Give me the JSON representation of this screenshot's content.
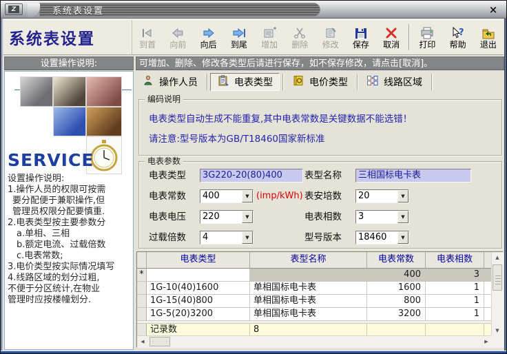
{
  "window": {
    "title": "系统表设置"
  },
  "icons": {
    "dropdown_arrow": "▼",
    "scroll_up": "▲",
    "scroll_down": "▼",
    "scroll_left": "◀",
    "scroll_right": "▶",
    "close": "×",
    "logo_glyph": "Z"
  },
  "colors": {
    "accent_navy": "#23238f",
    "field_lavender": "#c9c9f0",
    "info_blue": "#2424b0",
    "warning_red": "#e00000",
    "header_gray": "#838587",
    "footer_yellow": "#fcfbdc"
  },
  "toolbar": {
    "app_title": "系统表设置",
    "buttons": [
      {
        "label": "到首",
        "enabled": false
      },
      {
        "label": "向前",
        "enabled": false
      },
      {
        "label": "向后",
        "enabled": true
      },
      {
        "label": "到尾",
        "enabled": true
      },
      {
        "label": "增加",
        "enabled": false
      },
      {
        "label": "删除",
        "enabled": false
      },
      {
        "label": "修改",
        "enabled": false
      },
      {
        "label": "保存",
        "enabled": true
      },
      {
        "label": "取消",
        "enabled": true
      },
      {
        "label": "打印",
        "enabled": true
      },
      {
        "label": "帮助",
        "enabled": true
      },
      {
        "label": "退出",
        "enabled": true
      }
    ]
  },
  "left_panel": {
    "header": "设置操作说明:",
    "service_text": "SERVICE",
    "instructions": [
      "设置操作说明:",
      "1.操作人员的权限可按需",
      "要分配便于兼职操作,但",
      "管理员权限分配要慎重.",
      "2.电表类型按主要参数分",
      "a.单相、三相",
      "b.额定电流、过载倍数",
      "c.电表常数;",
      "3.电价类型按实际情况填写",
      "4.线路区域的划分过粗,",
      "不便于分区统计,在物业",
      "管理时应按楼幢划分."
    ]
  },
  "right_panel": {
    "notice": "可增加、删除、修改各类型后请进行保存，如不保存修改，请点击[取消]。",
    "tabs": [
      {
        "label": "操作人员",
        "active": false
      },
      {
        "label": "电表类型",
        "active": true
      },
      {
        "label": "电价类型",
        "active": false
      },
      {
        "label": "线路区域",
        "active": false
      }
    ],
    "coding_group": {
      "title": "编码说明",
      "line1": "电表类型自动生成不能重复,其中电表常数是关键数据不能选错！",
      "line2": "请注意:型号版本为GB/T18460国家新标准"
    },
    "params_group": {
      "title": "电表参数",
      "meter_type": {
        "label": "电表类型",
        "value": "3G220-20(80)400"
      },
      "model_name": {
        "label": "表型名称",
        "value": "三相国标电卡表"
      },
      "meter_constant": {
        "label": "电表常数",
        "value": "400",
        "suffix": "(imp/kWh)"
      },
      "ampere": {
        "label": "表安培数",
        "value": "20"
      },
      "voltage": {
        "label": "电表电压",
        "value": "220"
      },
      "phases": {
        "label": "电表相数",
        "value": "3"
      },
      "overload": {
        "label": "过载倍数",
        "value": "4"
      },
      "model_version": {
        "label": "型号版本",
        "value": "18460"
      }
    },
    "table": {
      "columns": [
        "电表类型",
        "表型名称",
        "电表常数",
        "电表相数"
      ],
      "new_row": {
        "indicator": "*",
        "type": "",
        "name": "",
        "constant": "400",
        "phases": "3"
      },
      "rows": [
        {
          "type": "1G-10(40)1600",
          "name": "单相国标电卡表",
          "constant": "1600",
          "phases": "1"
        },
        {
          "type": "1G-15(40)800",
          "name": "单相国标电卡表",
          "constant": "800",
          "phases": "1"
        },
        {
          "type": "1G-5(20)3200",
          "name": "单相国标电卡表",
          "constant": "3200",
          "phases": "1"
        }
      ],
      "footer": {
        "label": "记录数",
        "value": "8"
      }
    }
  }
}
